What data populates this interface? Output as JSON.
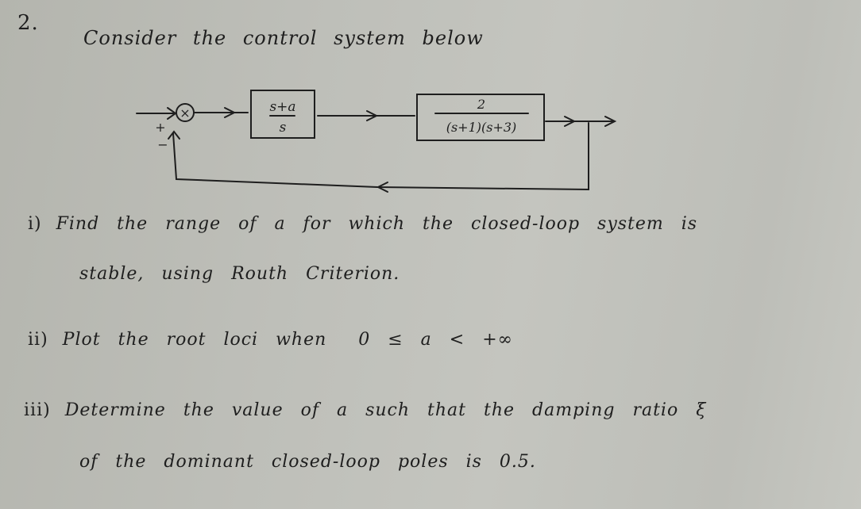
{
  "problem": {
    "number": "2.",
    "intro": "Consider the control system below"
  },
  "diagram": {
    "summing_junction": {
      "symbol": "×",
      "plus_sign": "+",
      "minus_sign": "−"
    },
    "controller_block": {
      "numerator": "s+a",
      "denominator": "s"
    },
    "plant_block": {
      "numerator": "2",
      "denominator": "(s+1)(s+3)"
    },
    "feedback": "unity negative feedback"
  },
  "parts": [
    {
      "marker": "i)",
      "line1": "Find the range of a for which the closed-loop system is",
      "line2": "stable, using Routh Criterion."
    },
    {
      "marker": "ii)",
      "line1": "Plot the root loci when",
      "condition": "0 ≤ a < +∞"
    },
    {
      "marker": "iii)",
      "line1": "Determine the value of a such that the damping ratio ξ",
      "line2": "of the dominant closed-loop poles is 0.5."
    }
  ]
}
